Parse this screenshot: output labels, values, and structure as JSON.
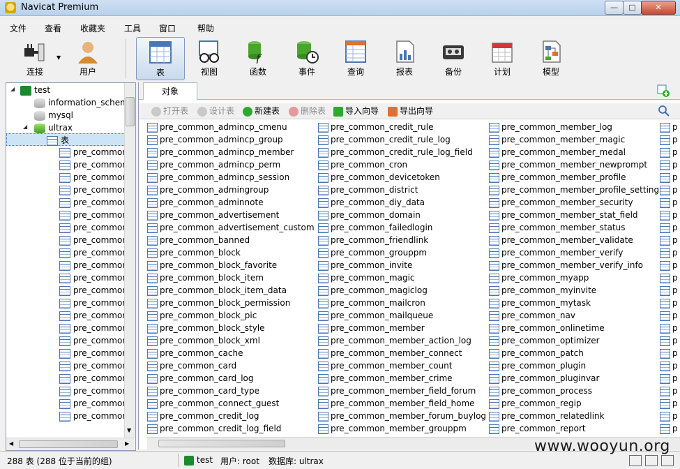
{
  "window": {
    "title": "Navicat Premium"
  },
  "menu": [
    "文件",
    "查看",
    "收藏夹",
    "工具",
    "窗口",
    "帮助"
  ],
  "toolbar": [
    {
      "label": "连接",
      "icon": "plug-icon"
    },
    {
      "label": "用户",
      "icon": "user-icon"
    },
    {
      "label": "表",
      "icon": "table-icon",
      "active": true
    },
    {
      "label": "视图",
      "icon": "view-glasses-icon"
    },
    {
      "label": "函数",
      "icon": "function-icon"
    },
    {
      "label": "事件",
      "icon": "event-clock-icon"
    },
    {
      "label": "查询",
      "icon": "query-icon"
    },
    {
      "label": "报表",
      "icon": "report-icon"
    },
    {
      "label": "备份",
      "icon": "backup-tape-icon"
    },
    {
      "label": "计划",
      "icon": "calendar-icon"
    },
    {
      "label": "模型",
      "icon": "model-icon"
    }
  ],
  "tree": {
    "connection": "test",
    "databases": [
      "information_schema",
      "mysql",
      "ultrax"
    ],
    "tables_node": "表",
    "items": [
      "pre_common_a",
      "pre_common_a",
      "pre_common_a",
      "pre_common_a",
      "pre_common_a",
      "pre_common_a",
      "pre_common_a",
      "pre_common_a",
      "pre_common_a",
      "pre_common_b",
      "pre_common_b",
      "pre_common_b",
      "pre_common_b",
      "pre_common_b",
      "pre_common_b",
      "pre_common_b",
      "pre_common_b",
      "pre_common_b",
      "pre_common_c",
      "pre_common_c",
      "pre_common_c",
      "pre_common_c"
    ]
  },
  "tab": {
    "label": "对象"
  },
  "objbar": [
    {
      "label": "打开表",
      "disabled": true
    },
    {
      "label": "设计表",
      "disabled": true
    },
    {
      "label": "新建表",
      "disabled": false
    },
    {
      "label": "删除表",
      "disabled": true
    },
    {
      "label": "导入向导",
      "disabled": false
    },
    {
      "label": "导出向导",
      "disabled": false
    }
  ],
  "columns": [
    [
      "pre_common_admincp_cmenu",
      "pre_common_admincp_group",
      "pre_common_admincp_member",
      "pre_common_admincp_perm",
      "pre_common_admincp_session",
      "pre_common_admingroup",
      "pre_common_adminnote",
      "pre_common_advertisement",
      "pre_common_advertisement_custom",
      "pre_common_banned",
      "pre_common_block",
      "pre_common_block_favorite",
      "pre_common_block_item",
      "pre_common_block_item_data",
      "pre_common_block_permission",
      "pre_common_block_pic",
      "pre_common_block_style",
      "pre_common_block_xml",
      "pre_common_cache",
      "pre_common_card",
      "pre_common_card_log",
      "pre_common_card_type",
      "pre_common_connect_guest",
      "pre_common_credit_log",
      "pre_common_credit_log_field"
    ],
    [
      "pre_common_credit_rule",
      "pre_common_credit_rule_log",
      "pre_common_credit_rule_log_field",
      "pre_common_cron",
      "pre_common_devicetoken",
      "pre_common_district",
      "pre_common_diy_data",
      "pre_common_domain",
      "pre_common_failedlogin",
      "pre_common_friendlink",
      "pre_common_grouppm",
      "pre_common_invite",
      "pre_common_magic",
      "pre_common_magiclog",
      "pre_common_mailcron",
      "pre_common_mailqueue",
      "pre_common_member",
      "pre_common_member_action_log",
      "pre_common_member_connect",
      "pre_common_member_count",
      "pre_common_member_crime",
      "pre_common_member_field_forum",
      "pre_common_member_field_home",
      "pre_common_member_forum_buylog",
      "pre_common_member_grouppm"
    ],
    [
      "pre_common_member_log",
      "pre_common_member_magic",
      "pre_common_member_medal",
      "pre_common_member_newprompt",
      "pre_common_member_profile",
      "pre_common_member_profile_setting",
      "pre_common_member_security",
      "pre_common_member_stat_field",
      "pre_common_member_status",
      "pre_common_member_validate",
      "pre_common_member_verify",
      "pre_common_member_verify_info",
      "pre_common_myapp",
      "pre_common_myinvite",
      "pre_common_mytask",
      "pre_common_nav",
      "pre_common_onlinetime",
      "pre_common_optimizer",
      "pre_common_patch",
      "pre_common_plugin",
      "pre_common_pluginvar",
      "pre_common_process",
      "pre_common_regip",
      "pre_common_relatedlink",
      "pre_common_report"
    ],
    [
      "p",
      "p",
      "p",
      "p",
      "p",
      "p",
      "p",
      "p",
      "p",
      "p",
      "p",
      "p",
      "p",
      "p",
      "p",
      "p",
      "p",
      "p",
      "p",
      "p",
      "p",
      "p",
      "p",
      "p",
      "p"
    ]
  ],
  "status": {
    "count": "288 表 (288 位于当前的组)",
    "connection": "test",
    "user": "用户: root",
    "database": "数据库: ultrax"
  },
  "watermark": "www.wooyun.org",
  "colors": {
    "accent": "#3d7bc4",
    "selected": "#cde4f7",
    "table_icon": "#4a77b3"
  }
}
